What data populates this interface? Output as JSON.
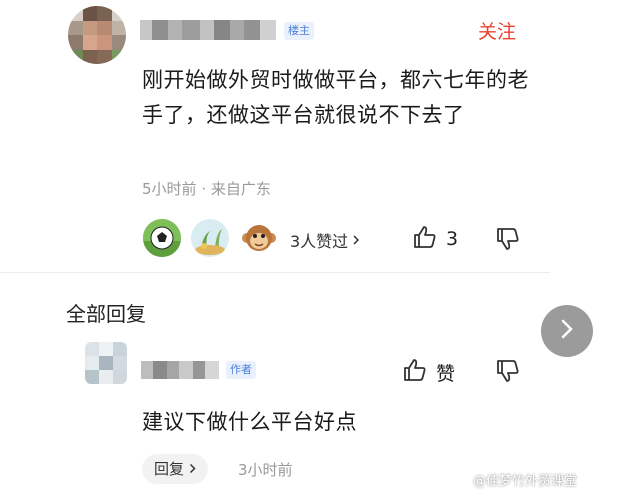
{
  "post": {
    "op_badge": "楼主",
    "follow_label": "关注",
    "content": "刚开始做外贸时做做平台，都六七年的老手了，还做这平台就很说不下去了",
    "time": "5小时前",
    "location": "来自广东",
    "liked_count_label": "3人赞过",
    "like_count": "3"
  },
  "replies_section": {
    "title": "全部回复"
  },
  "reply": {
    "author_badge": "作者",
    "like_label": "赞",
    "content": "建议下做什么平台好点",
    "reply_button_label": "回复",
    "time": "3小时前"
  },
  "watermark": "@佳梦竹外贸课堂",
  "colors": {
    "accent_red": "#e8432f",
    "badge_blue": "#4a7fd4",
    "meta_gray": "#9a9a9a"
  }
}
